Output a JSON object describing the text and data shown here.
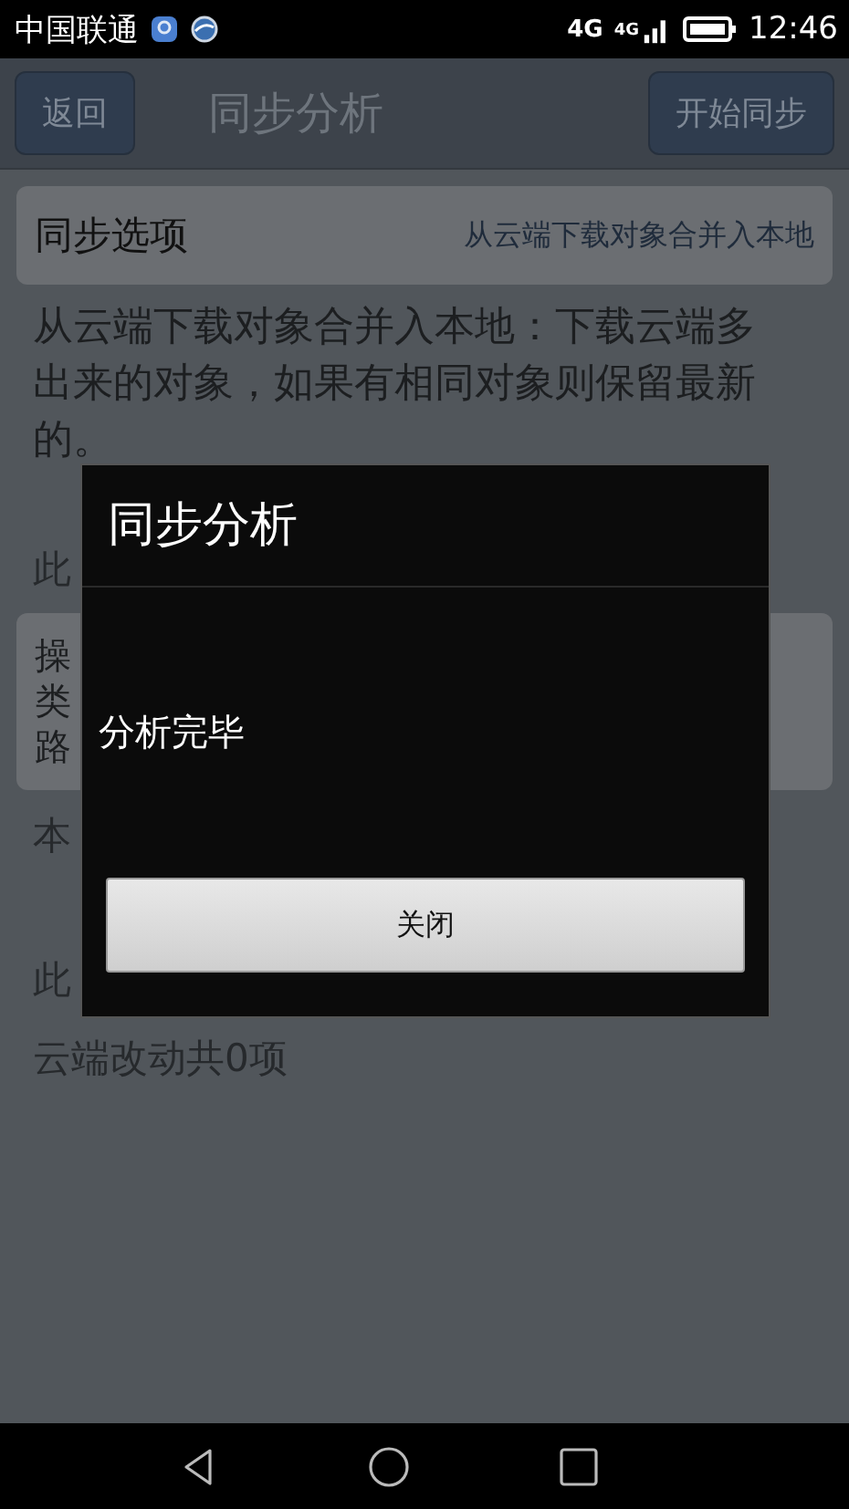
{
  "status_bar": {
    "carrier": "中国联通",
    "network_1": "4G",
    "network_2": "4G",
    "time": "12:46"
  },
  "action_bar": {
    "back": "返回",
    "title": "同步分析",
    "action": "开始同步"
  },
  "sync_option": {
    "label": "同步选项",
    "value": "从云端下载对象合并入本地"
  },
  "description": "从云端下载对象合并入本地：下载云端多出来的对象，如果有相同对象则保留最新的。",
  "local_heading": "此",
  "change_lines": [
    "操",
    "类",
    "路"
  ],
  "local_count": "本",
  "cloud_heading": "此",
  "cloud_count": "云端改动共0项",
  "dialog": {
    "title": "同步分析",
    "message": "分析完毕",
    "button": "关闭"
  }
}
